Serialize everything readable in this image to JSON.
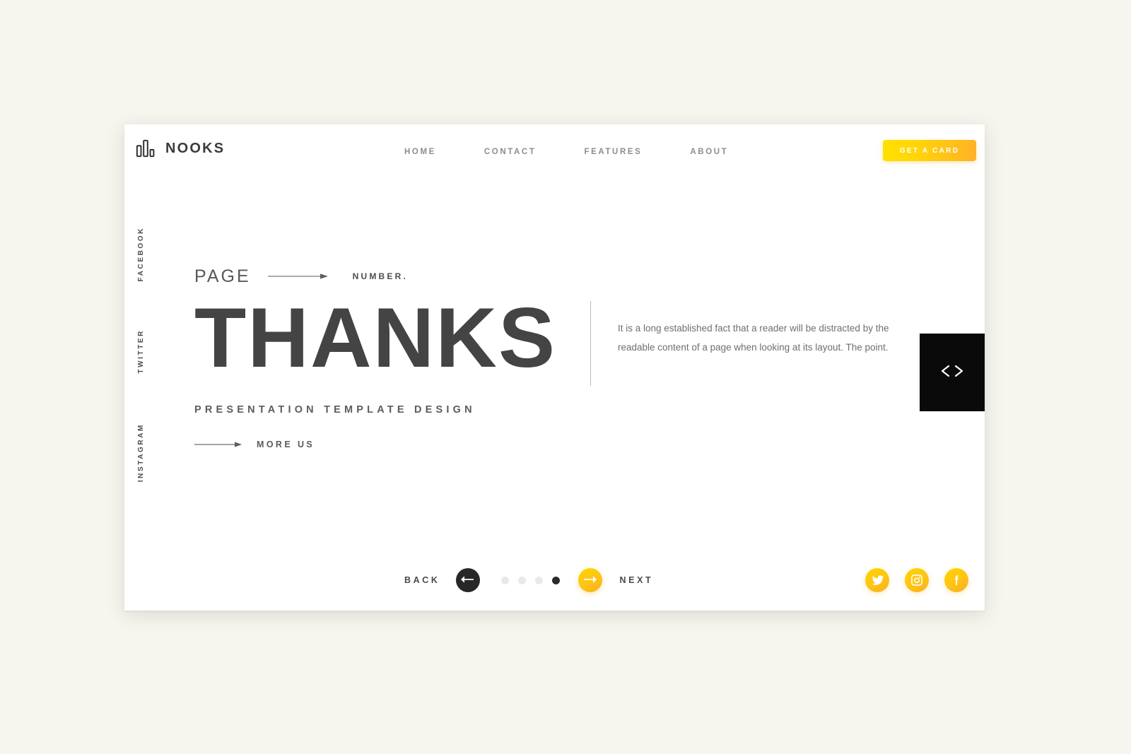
{
  "page": {
    "background_color": "#f6f5ee",
    "card_background": "#ffffff"
  },
  "header": {
    "brand": {
      "name": "NOOKS",
      "logo_icon": "bar-chart-logo-icon"
    },
    "nav": [
      {
        "label": "HOME"
      },
      {
        "label": "CONTACT"
      },
      {
        "label": "FEATURES"
      },
      {
        "label": "ABOUT"
      }
    ],
    "cta": {
      "label": "GET A CARD",
      "gradient_from": "#ffe000",
      "gradient_to": "#ffb127",
      "text_color": "#ffffff"
    }
  },
  "social_rail": [
    {
      "label": "FACEBOOK"
    },
    {
      "label": "TWITTER"
    },
    {
      "label": "INSTAGRAM"
    }
  ],
  "main": {
    "eyebrow_left": "PAGE",
    "eyebrow_right": "NUMBER.",
    "headline": "THANKS",
    "paragraph": "It is a long established fact that a reader will be distracted by the readable content of a page when looking at its layout. The point.",
    "subtitle": "PRESENTATION TEMPLATE DESIGN",
    "more_link": "MORE US",
    "headline_color": "#444444",
    "divider_color": "#b9b9b9"
  },
  "code_badge": {
    "icon": "code-brackets-icon",
    "glyph": "❮❯",
    "background": "#0a0a0a",
    "icon_color": "#ffffff"
  },
  "controls": {
    "back_label": "BACK",
    "next_label": "NEXT",
    "prev_button_color": "#272727",
    "next_button_color": "#ffc416",
    "dots": [
      {
        "active": false
      },
      {
        "active": false
      },
      {
        "active": false
      },
      {
        "active": true
      }
    ],
    "active_dot_index": 4,
    "total_dots": 4
  },
  "social_buttons": [
    {
      "name": "twitter",
      "icon": "twitter-icon"
    },
    {
      "name": "instagram",
      "icon": "instagram-icon"
    },
    {
      "name": "facebook",
      "icon": "facebook-icon"
    }
  ]
}
